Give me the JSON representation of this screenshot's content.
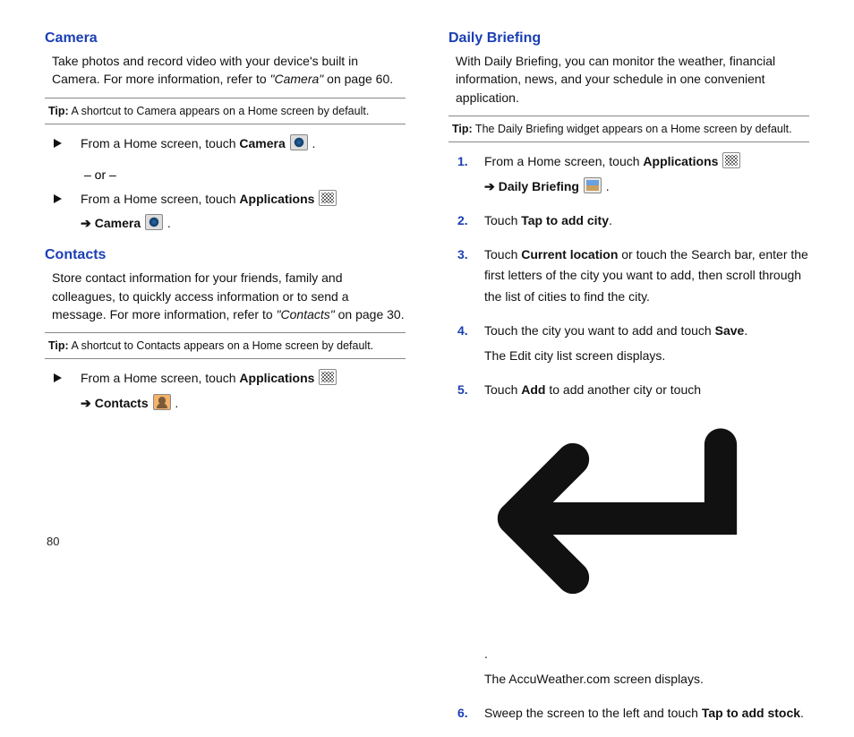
{
  "page_number": "80",
  "left": {
    "camera": {
      "title": "Camera",
      "body_pre": "Take photos and record video with your device's built in Camera. For more information, refer to ",
      "body_italic": "\"Camera\"",
      "body_post": "  on page 60.",
      "tip_label": "Tip:",
      "tip_text": " A shortcut to Camera appears on a Home screen by default.",
      "step1_pre": "From a Home screen, touch ",
      "step1_bold": "Camera",
      "or_text": "– or –",
      "step2_pre": "From a Home screen, touch ",
      "step2_bold": "Applications",
      "step2_sub_bold": "Camera"
    },
    "contacts": {
      "title": "Contacts",
      "body_pre": "Store contact information for your friends, family and colleagues, to quickly access information or to send a message. For more information, refer to ",
      "body_italic": "\"Contacts\"",
      "body_post": "  on page 30.",
      "tip_label": "Tip:",
      "tip_text": " A shortcut to Contacts appears on a Home screen by default.",
      "step_pre": "From a Home screen, touch ",
      "step_bold": "Applications",
      "step_sub_bold": "Contacts"
    }
  },
  "right": {
    "title": "Daily Briefing",
    "body": "With Daily Briefing, you can monitor the weather, financial information, news, and your schedule in one convenient application.",
    "tip_label": "Tip:",
    "tip_text": " The Daily Briefing widget appears on a Home screen by default.",
    "steps": {
      "n1": "1.",
      "s1_pre": "From a Home screen, touch ",
      "s1_bold": "Applications",
      "s1_sub_bold": "Daily Briefing",
      "n2": "2.",
      "s2_pre": "Touch ",
      "s2_bold": "Tap to add city",
      "s2_post": ".",
      "n3": "3.",
      "s3_pre": "Touch ",
      "s3_bold": "Current location",
      "s3_post": " or touch the Search bar, enter the first letters of the city you want to add, then scroll through the list of cities to find the city.",
      "n4": "4.",
      "s4_pre": "Touch the city you want to add and touch ",
      "s4_bold": "Save",
      "s4_post": ".",
      "s4_line2": "The Edit city list screen displays.",
      "n5": "5.",
      "s5_pre": "Touch ",
      "s5_bold": "Add",
      "s5_mid": " to add another city or touch ",
      "s5_post": ".",
      "s5_line2": "The AccuWeather.com screen displays.",
      "n6": "6.",
      "s6_pre": "Sweep the screen to the left and touch ",
      "s6_bold": "Tap to add stock",
      "s6_post": "."
    }
  }
}
